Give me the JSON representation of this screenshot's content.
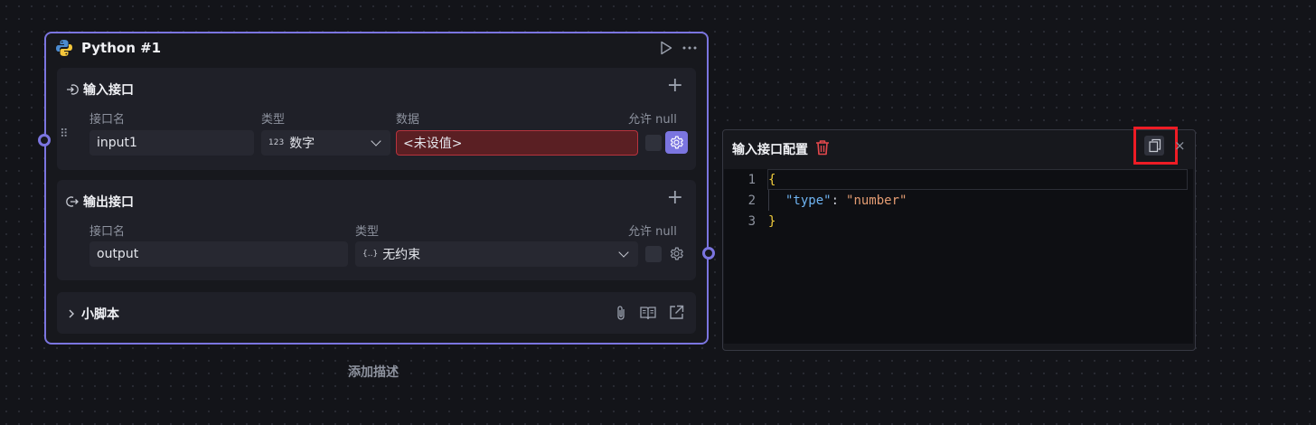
{
  "node": {
    "title": "Python #1",
    "input_section": {
      "title": "输入接口",
      "columns": [
        "接口名",
        "类型",
        "数据",
        "允许 null"
      ],
      "row": {
        "name": "input1",
        "type_icon": "123",
        "type": "数字",
        "data": "<未设值>"
      }
    },
    "output_section": {
      "title": "输出接口",
      "columns": [
        "接口名",
        "类型",
        "允许 null"
      ],
      "row": {
        "name": "output",
        "type_icon": "{..}",
        "type": "无约束"
      }
    },
    "script_section": {
      "title": "小脚本"
    },
    "add_description": "添加描述"
  },
  "config_panel": {
    "title": "输入接口配置",
    "code": {
      "line_numbers": [
        "1",
        "2",
        "3"
      ],
      "open_brace": "{",
      "key": "\"type\"",
      "colon": ":",
      "value": "\"number\"",
      "close_brace": "}"
    }
  },
  "colors": {
    "accent": "#7b75e0",
    "error_bg": "#5a1f23",
    "error_border": "#b8333d",
    "highlight": "#ee1c25",
    "delete_icon": "#e5484d"
  },
  "icons": [
    "python-logo-icon",
    "play-icon",
    "more-icon",
    "input-port-icon",
    "plus-icon",
    "drag-handle-icon",
    "chevron-down-icon",
    "gear-icon",
    "output-port-icon",
    "chevron-right-icon",
    "attachment-icon",
    "book-icon",
    "external-link-icon",
    "trash-icon",
    "copy-icon",
    "close-icon"
  ]
}
